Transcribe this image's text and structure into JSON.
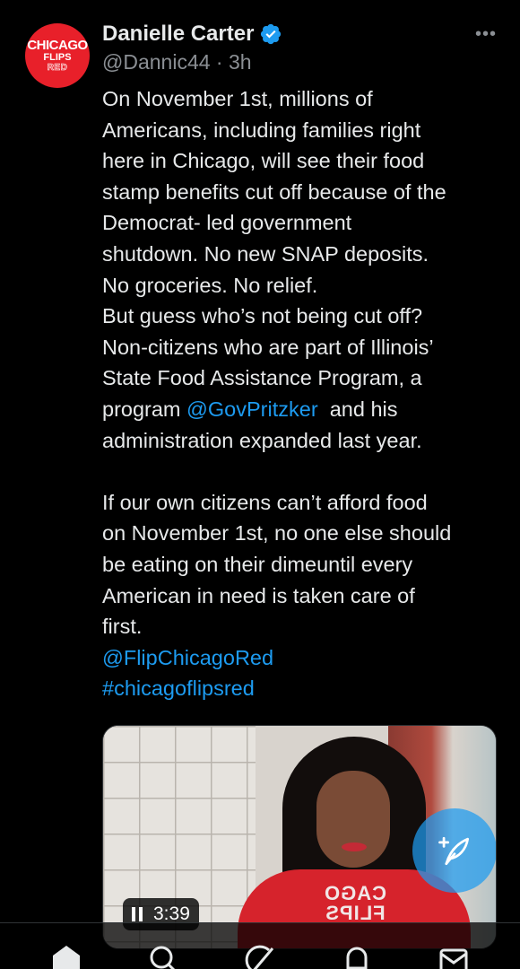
{
  "post": {
    "avatar": {
      "line1": "CHICAGO",
      "line2": "FLIPS",
      "line3": "RED"
    },
    "author": {
      "display_name": "Danielle Carter",
      "handle": "@Dannic44",
      "separator": "·",
      "time": "3h",
      "verified": true
    },
    "more_label": "•••",
    "body": {
      "lines1": [
        "On November 1st, millions of",
        "Americans, including families right",
        "here in Chicago, will see their food",
        "stamp benefits cut off because of the",
        "Democrat- led government",
        "shutdown. No new SNAP deposits.",
        "No groceries. No relief.",
        "But guess who’s not being cut off?",
        "Non-citizens who are part of Illinois’",
        "State Food Assistance Program, a"
      ],
      "mention_line_pre": "program ",
      "mention": "@GovPritzker",
      "mention_line_post": "  and his",
      "line_after_mention": "administration expanded last year.",
      "lines2": [
        "If our own citizens can’t afford food",
        "on November 1st, no one else should",
        "be eating on their dimeuntil every",
        "American in need is taken care of",
        "first."
      ],
      "tag_mention": "@FlipChicagoRed",
      "hashtag": "#chicagoflipsred"
    },
    "video": {
      "duration": "3:39",
      "hoodie_text_line1": "CAGO",
      "hoodie_text_line2": "FLIPS"
    }
  },
  "nav": [
    "home-icon",
    "search-icon",
    "grok-icon",
    "notifications-icon",
    "messages-icon"
  ],
  "colors": {
    "accent": "#1d9bf0",
    "background": "#000000",
    "text": "#e7e9ea",
    "muted": "#8b8f94",
    "brand_red": "#e8202a"
  }
}
